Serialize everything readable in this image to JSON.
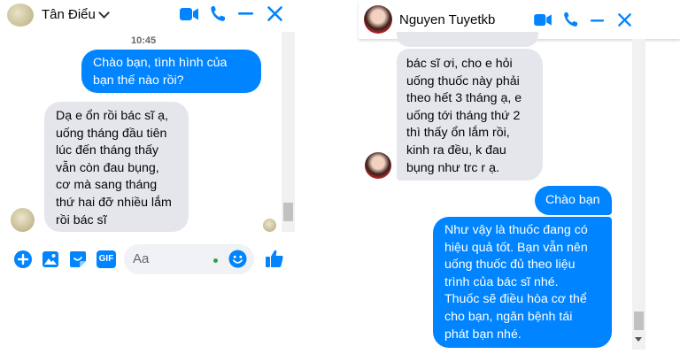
{
  "colors": {
    "messenger_blue": "#0084ff",
    "incoming_bubble": "#e4e6eb",
    "online_green": "#31a24c"
  },
  "left_chat": {
    "contact_name": "Tân Điểu",
    "timestamp": "10:45",
    "messages": [
      {
        "from": "me",
        "lines": [
          "Chào bạn, tình hình của",
          "bạn thế nào rồi?"
        ]
      },
      {
        "from": "contact",
        "lines": [
          "Dạ e ổn rồi bác sĩ ạ,",
          "uống tháng đầu tiên",
          "lúc đến tháng thấy",
          "vẫn còn đau bụng,",
          "cơ mà sang tháng",
          "thứ hai đỡ nhiều lắm",
          "rồi bác sĩ"
        ]
      }
    ],
    "composer": {
      "placeholder": "Aa",
      "icons": [
        "plus-icon",
        "image-icon",
        "sticker-icon",
        "gif-icon",
        "emoji-icon",
        "like-icon"
      ],
      "gif_label": "GIF"
    }
  },
  "right_chat": {
    "contact_name": "Nguyen Tuyetkb",
    "messages": [
      {
        "from": "contact",
        "lines": [
          "bác sĩ ơi, cho e hỏi",
          "uống thuốc này phải",
          "theo hết 3 tháng ạ, e",
          "uống tới tháng thứ 2",
          "thì thấy ổn lắm rồi,",
          "kinh ra đều, k đau",
          "bụng như trc r ạ."
        ]
      },
      {
        "from": "me",
        "lines": [
          "Chào bạn"
        ]
      },
      {
        "from": "me",
        "lines": [
          "Như vậy là thuốc đang có",
          "hiệu quả tốt. Bạn vẫn nên",
          "uống thuốc đủ theo liệu",
          "trình của bác sĩ nhé.",
          "Thuốc sẽ điều hòa cơ thể",
          "cho bạn, ngăn bệnh tái",
          "phát bạn nhé."
        ]
      }
    ]
  }
}
